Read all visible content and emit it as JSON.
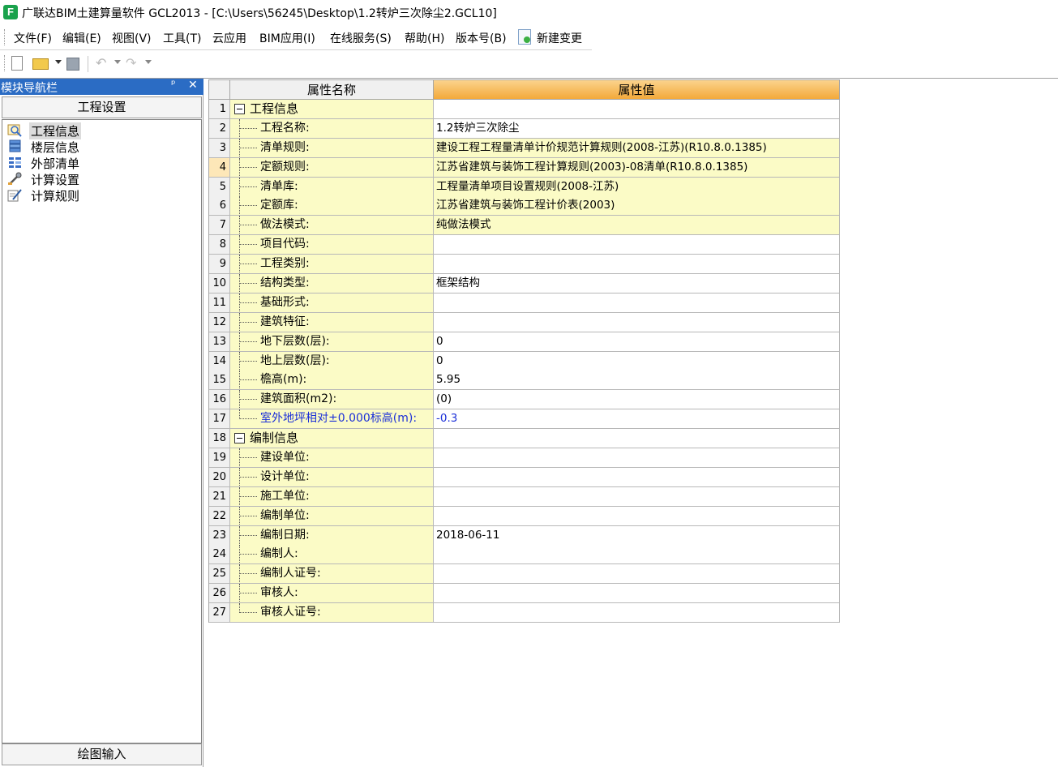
{
  "window": {
    "app_icon": "F",
    "title": "广联达BIM土建算量软件 GCL2013 - [C:\\Users\\56245\\Desktop\\1.2转炉三次除尘2.GCL10]"
  },
  "menubar": {
    "items": [
      "文件(F)",
      "编辑(E)",
      "视图(V)",
      "工具(T)",
      "云应用",
      "BIM应用(I)",
      "在线服务(S)",
      "帮助(H)",
      "版本号(B)"
    ],
    "new_change_label": "新建变更",
    "new_change_icon": "new-change-icon"
  },
  "toolbar": {
    "icons": [
      "new-file-icon",
      "open-folder-icon",
      "save-icon",
      "undo-icon",
      "redo-icon"
    ]
  },
  "nav": {
    "title": "模块导航栏",
    "pin_glyph": "ᵖ",
    "close_glyph": "✕",
    "section_title": "工程设置",
    "items": [
      {
        "label": "工程信息",
        "icon": "project-info-icon",
        "selected": true
      },
      {
        "label": "楼层信息",
        "icon": "floor-info-icon"
      },
      {
        "label": "外部清单",
        "icon": "external-list-icon"
      },
      {
        "label": "计算设置",
        "icon": "calc-settings-icon"
      },
      {
        "label": "计算规则",
        "icon": "calc-rules-icon"
      }
    ],
    "bottom_tab": "绘图输入"
  },
  "grid": {
    "header_name": "属性名称",
    "header_value": "属性值",
    "rows": [
      {
        "n": "1",
        "name": "工程信息",
        "value": "",
        "group": true
      },
      {
        "n": "2",
        "name": "工程名称:",
        "value": "1.2转炉三次除尘",
        "hl": false
      },
      {
        "n": "3",
        "name": "清单规则:",
        "value": "建设工程工程量清单计价规范计算规则(2008-江苏)(R10.8.0.1385)",
        "hl": true
      },
      {
        "n": "4",
        "name": "定额规则:",
        "value": "江苏省建筑与装饰工程计算规则(2003)-08清单(R10.8.0.1385)",
        "hl": true,
        "current": true
      },
      {
        "n": "5",
        "name": "清单库:",
        "value": "工程量清单项目设置规则(2008-江苏)",
        "hl": true
      },
      {
        "n": "6",
        "name": "定额库:",
        "value": "江苏省建筑与装饰工程计价表(2003)",
        "hl": true
      },
      {
        "n": "7",
        "name": "做法模式:",
        "value": "纯做法模式",
        "hl": true
      },
      {
        "n": "8",
        "name": "项目代码:",
        "value": ""
      },
      {
        "n": "9",
        "name": "工程类别:",
        "value": ""
      },
      {
        "n": "10",
        "name": "结构类型:",
        "value": "框架结构"
      },
      {
        "n": "11",
        "name": "基础形式:",
        "value": ""
      },
      {
        "n": "12",
        "name": "建筑特征:",
        "value": ""
      },
      {
        "n": "13",
        "name": "地下层数(层):",
        "value": "0"
      },
      {
        "n": "14",
        "name": "地上层数(层):",
        "value": "0"
      },
      {
        "n": "15",
        "name": "檐高(m):",
        "value": "5.95"
      },
      {
        "n": "16",
        "name": "建筑面积(m2):",
        "value": "(0)"
      },
      {
        "n": "17",
        "name": "室外地坪相对±0.000标高(m):",
        "value": "-0.3",
        "blue": true
      },
      {
        "n": "18",
        "name": "编制信息",
        "value": "",
        "group": true
      },
      {
        "n": "19",
        "name": "建设单位:",
        "value": ""
      },
      {
        "n": "20",
        "name": "设计单位:",
        "value": ""
      },
      {
        "n": "21",
        "name": "施工单位:",
        "value": ""
      },
      {
        "n": "22",
        "name": "编制单位:",
        "value": ""
      },
      {
        "n": "23",
        "name": "编制日期:",
        "value": "2018-06-11"
      },
      {
        "n": "24",
        "name": "编制人:",
        "value": ""
      },
      {
        "n": "25",
        "name": "编制人证号:",
        "value": ""
      },
      {
        "n": "26",
        "name": "审核人:",
        "value": ""
      },
      {
        "n": "27",
        "name": "审核人证号:",
        "value": "",
        "last": true
      }
    ]
  }
}
